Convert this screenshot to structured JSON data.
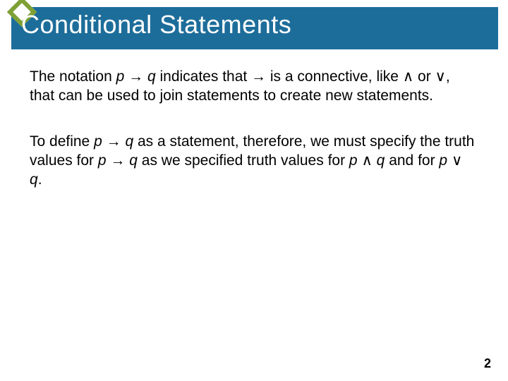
{
  "title": "Conditional Statements",
  "p1": {
    "t1": "The notation ",
    "p": "p",
    "arrow1": " → ",
    "q": "q",
    "t2": " indicates that → is a connective, like ",
    "and": "∧",
    "t3": " or ",
    "or": "∨",
    "t4": ", that can be used to join statements to create new statements."
  },
  "p2": {
    "t1": "To define ",
    "p": "p",
    "arrow1": " → ",
    "q": "q",
    "t2": " as a statement, therefore, we must specify the truth values for ",
    "p2": "p",
    "arrow2": " → ",
    "q2": "q",
    "t3": " as we specified truth values for ",
    "p3": "p",
    "sp": " ",
    "and": "∧",
    "sp2": " ",
    "q3": "q",
    "t4": " and for ",
    "p4": "p",
    "sp3": " ",
    "or": "∨",
    "sp4": " ",
    "q4": "q",
    "t5": "."
  },
  "pagenum": "2"
}
